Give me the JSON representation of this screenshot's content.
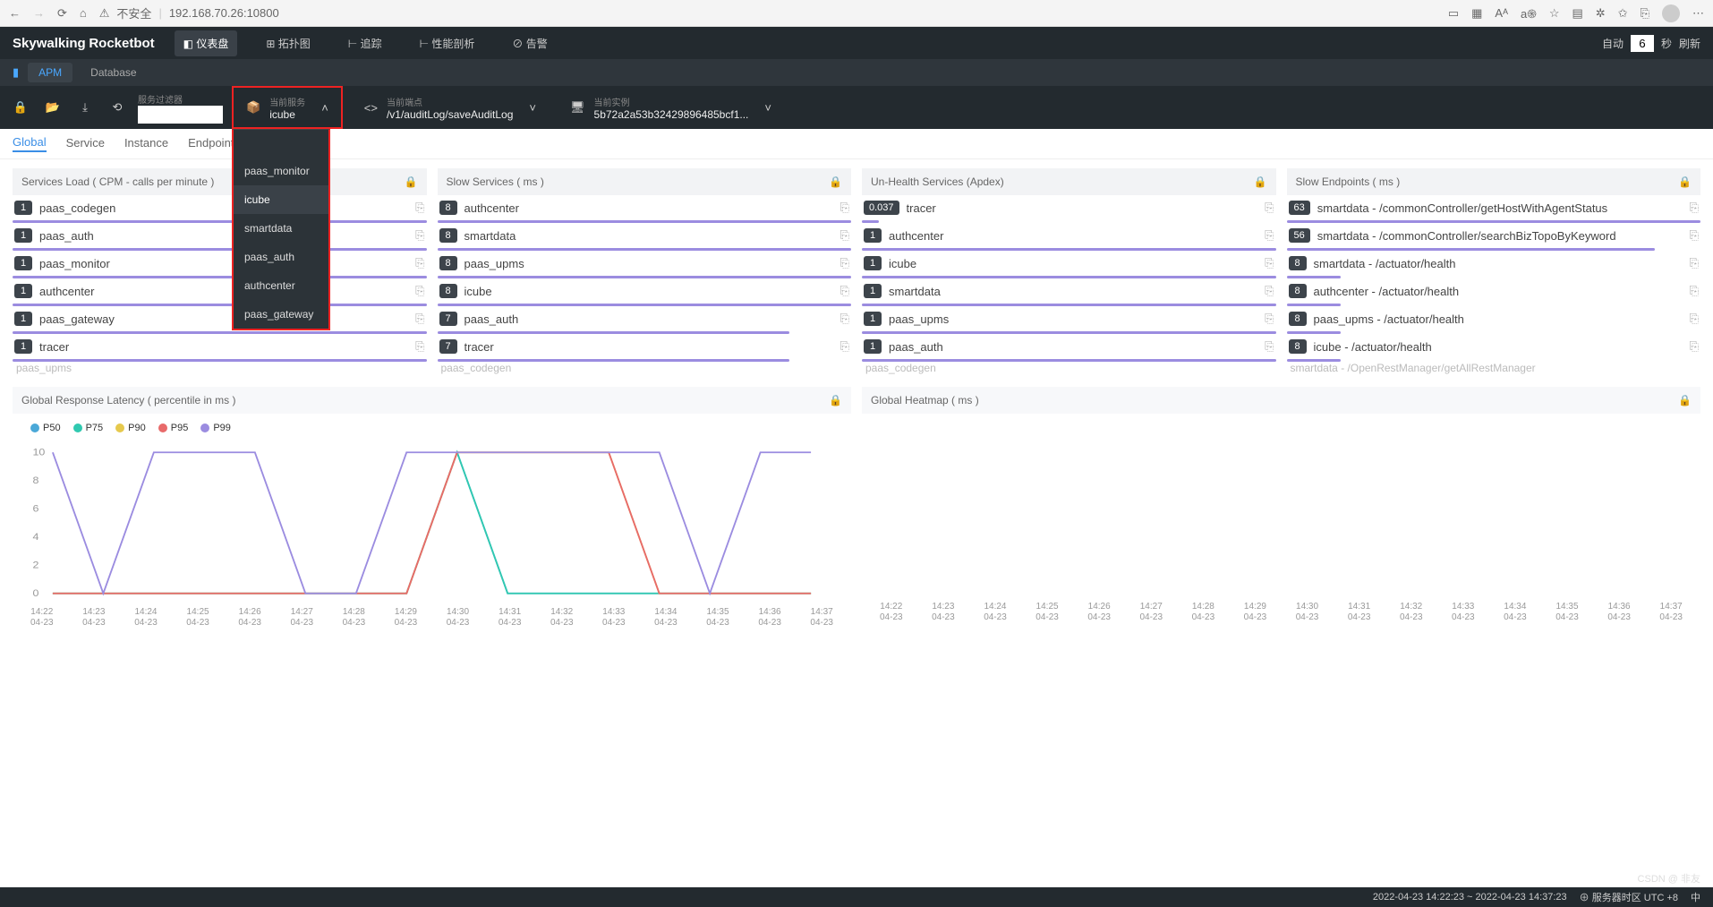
{
  "browser": {
    "insecure": "不安全",
    "address": "192.168.70.26:10800"
  },
  "brand": {
    "title": "Skywalking",
    "sub": "Rocketbot"
  },
  "topnav": {
    "tabs": [
      "仪表盘",
      "拓扑图",
      "追踪",
      "性能剖析",
      "告警"
    ],
    "auto": "自动",
    "interval": "6",
    "unit": "秒",
    "refresh": "刷新"
  },
  "modtabs": {
    "apm": "APM",
    "database": "Database"
  },
  "filterbar": {
    "filter_label": "服务过滤器",
    "cur_service_label": "当前服务",
    "cur_service_value": "icube",
    "cur_endpoint_label": "当前端点",
    "cur_endpoint_value": "/v1/auditLog/saveAuditLog",
    "cur_instance_label": "当前实例",
    "cur_instance_value": "5b72a2a53b32429896485bcf1..."
  },
  "dropdown": [
    "paas_monitor",
    "icube",
    "smartdata",
    "paas_auth",
    "authcenter",
    "paas_gateway"
  ],
  "subtabs": [
    "Global",
    "Service",
    "Instance",
    "Endpoint"
  ],
  "panels": {
    "services_load": {
      "title": "Services Load ( CPM - calls per minute )",
      "items": [
        {
          "v": "1",
          "label": "paas_codegen",
          "bar": 100
        },
        {
          "v": "1",
          "label": "paas_auth",
          "bar": 100
        },
        {
          "v": "1",
          "label": "paas_monitor",
          "bar": 100
        },
        {
          "v": "1",
          "label": "authcenter",
          "bar": 100
        },
        {
          "v": "1",
          "label": "paas_gateway",
          "bar": 100
        },
        {
          "v": "1",
          "label": "tracer",
          "bar": 100
        }
      ],
      "extra": "paas_upms"
    },
    "slow_services": {
      "title": "Slow Services ( ms )",
      "items": [
        {
          "v": "8",
          "label": "authcenter",
          "bar": 100
        },
        {
          "v": "8",
          "label": "smartdata",
          "bar": 100
        },
        {
          "v": "8",
          "label": "paas_upms",
          "bar": 100
        },
        {
          "v": "8",
          "label": "icube",
          "bar": 100
        },
        {
          "v": "7",
          "label": "paas_auth",
          "bar": 85
        },
        {
          "v": "7",
          "label": "tracer",
          "bar": 85
        }
      ],
      "extra": "paas_codegen"
    },
    "unhealth": {
      "title": "Un-Health Services (Apdex)",
      "items": [
        {
          "v": "0.037",
          "label": "tracer",
          "bar": 4
        },
        {
          "v": "1",
          "label": "authcenter",
          "bar": 100
        },
        {
          "v": "1",
          "label": "icube",
          "bar": 100
        },
        {
          "v": "1",
          "label": "smartdata",
          "bar": 100
        },
        {
          "v": "1",
          "label": "paas_upms",
          "bar": 100
        },
        {
          "v": "1",
          "label": "paas_auth",
          "bar": 100
        }
      ],
      "extra": "paas_codegen"
    },
    "slow_endpoints": {
      "title": "Slow Endpoints ( ms )",
      "items": [
        {
          "v": "63",
          "label": "smartdata - /commonController/getHostWithAgentStatus",
          "bar": 100
        },
        {
          "v": "56",
          "label": "smartdata - /commonController/searchBizTopoByKeyword",
          "bar": 89
        },
        {
          "v": "8",
          "label": "smartdata - /actuator/health",
          "bar": 13
        },
        {
          "v": "8",
          "label": "authcenter - /actuator/health",
          "bar": 13
        },
        {
          "v": "8",
          "label": "paas_upms - /actuator/health",
          "bar": 13
        },
        {
          "v": "8",
          "label": "icube - /actuator/health",
          "bar": 13
        }
      ],
      "extra": "smartdata - /OpenRestManager/getAllRestManager"
    }
  },
  "charts": {
    "latency": {
      "title": "Global Response Latency ( percentile in ms )"
    },
    "heatmap": {
      "title": "Global Heatmap ( ms )"
    },
    "legend": [
      "P50",
      "P75",
      "P90",
      "P95",
      "P99"
    ],
    "legend_colors": [
      "#4aa8d8",
      "#30c9b0",
      "#e6c94d",
      "#e86a6a",
      "#9b8ce0"
    ],
    "xcats": [
      "14:22",
      "14:23",
      "14:24",
      "14:25",
      "14:26",
      "14:27",
      "14:28",
      "14:29",
      "14:30",
      "14:31",
      "14:32",
      "14:33",
      "14:34",
      "14:35",
      "14:36",
      "14:37"
    ],
    "xdate": "04-23"
  },
  "chart_data": {
    "type": "line",
    "title": "Global Response Latency ( percentile in ms )",
    "xlabel": "",
    "ylabel": "",
    "ylim": [
      0,
      10
    ],
    "categories": [
      "14:22",
      "14:23",
      "14:24",
      "14:25",
      "14:26",
      "14:27",
      "14:28",
      "14:29",
      "14:30",
      "14:31",
      "14:32",
      "14:33",
      "14:34",
      "14:35",
      "14:36",
      "14:37"
    ],
    "series": [
      {
        "name": "P50",
        "values": [
          0,
          0,
          0,
          0,
          0,
          0,
          0,
          0,
          10,
          0,
          0,
          0,
          0,
          0,
          0,
          0
        ]
      },
      {
        "name": "P75",
        "values": [
          0,
          0,
          0,
          0,
          0,
          0,
          0,
          0,
          10,
          0,
          0,
          0,
          0,
          0,
          0,
          0
        ]
      },
      {
        "name": "P90",
        "values": [
          0,
          0,
          0,
          0,
          0,
          0,
          0,
          0,
          10,
          10,
          10,
          10,
          0,
          0,
          0,
          0
        ]
      },
      {
        "name": "P95",
        "values": [
          0,
          0,
          0,
          0,
          0,
          0,
          0,
          0,
          10,
          10,
          10,
          10,
          0,
          0,
          0,
          0
        ]
      },
      {
        "name": "P99",
        "values": [
          10,
          0,
          10,
          10,
          10,
          0,
          0,
          10,
          10,
          10,
          10,
          10,
          10,
          0,
          10,
          10
        ]
      }
    ]
  },
  "footer": {
    "timerange": "2022-04-23 14:22:23 ~ 2022-04-23 14:37:23",
    "tz": "服务器时区 UTC +8",
    "lang": "中"
  },
  "watermark": "CSDN @ 非友"
}
